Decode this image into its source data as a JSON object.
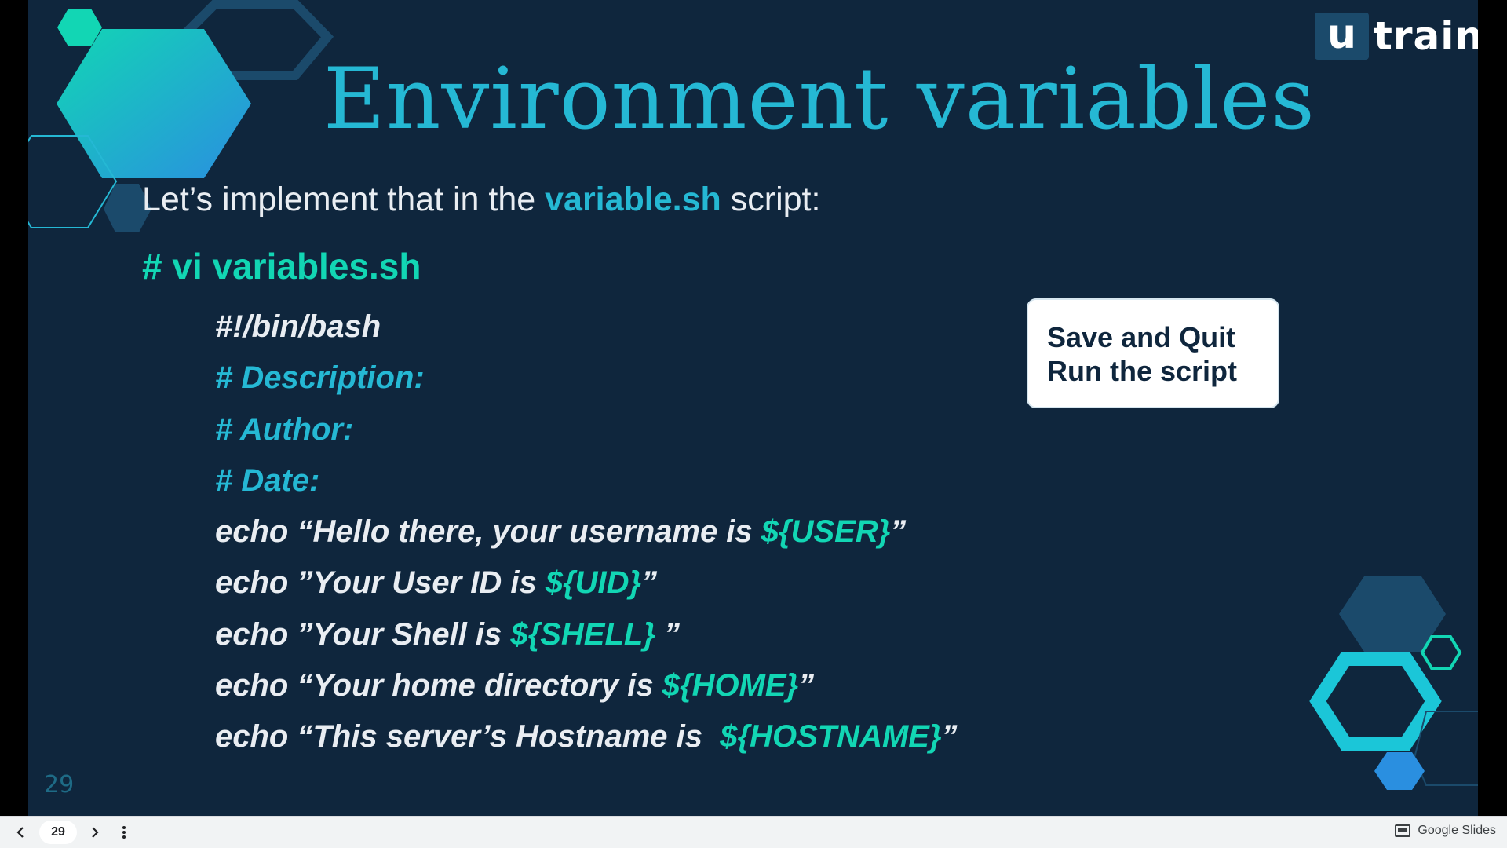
{
  "slide": {
    "title": "Environment variables",
    "intro_before": "Let’s implement that in the ",
    "intro_highlight": "variable.sh",
    "intro_after": " script:",
    "command": "# vi variables.sh",
    "code": {
      "shebang": "#!/bin/bash",
      "comment_description": "# Description:",
      "comment_author": "# Author:",
      "comment_date": "# Date:",
      "echo_user_pre": "echo “Hello there, your username is ",
      "echo_user_var": "${USER}",
      "echo_user_post": "”",
      "echo_uid_pre": "echo ”Your User ID is ",
      "echo_uid_var": "${UID}",
      "echo_uid_post": "”",
      "echo_shell_pre": "echo ”Your Shell is ",
      "echo_shell_var": "${SHELL}",
      "echo_shell_post": " ”",
      "echo_home_pre": "echo “Your home directory is ",
      "echo_home_var": "${HOME}",
      "echo_home_post": "”",
      "echo_host_pre": "echo “This server’s Hostname is  ",
      "echo_host_var": "${HOSTNAME}",
      "echo_host_post": "”"
    },
    "callout": {
      "line1": "Save and Quit",
      "line2": "Run the script"
    },
    "slide_number": "29",
    "logo": {
      "box_letter": "u",
      "text": "train"
    }
  },
  "bottombar": {
    "page_value": "29",
    "brand_label": "Google Slides",
    "icons": {
      "prev": "chevron-left-icon",
      "next": "chevron-right-icon",
      "more": "more-vert-icon",
      "brand": "slides-icon"
    }
  },
  "colors": {
    "background": "#0f263d",
    "accent_blue": "#25b8d4",
    "accent_green": "#12d6b4",
    "text": "#e9edf2"
  }
}
